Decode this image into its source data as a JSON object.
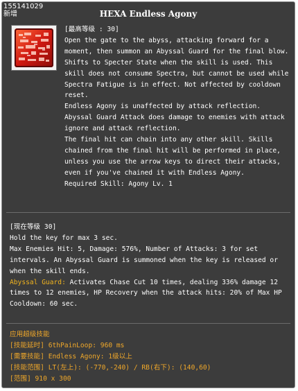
{
  "header": {
    "id": "155141029",
    "status": "新增"
  },
  "skill": {
    "name": "HEXA Endless Agony",
    "max_level_label": "[最高等级 : 30]",
    "description": [
      "Open the gate to the abyss, attacking forward for a moment, then summon an Abyssal Guard for the final blow. Shifts to Specter State when the skill is used. This skill does not consume Spectra, but cannot be used while Spectra Fatigue is in effect. Not affected by cooldown reset.",
      "Endless Agony is unaffected by attack reflection.",
      "Abyssal Guard Attack does damage to enemies with attack ignore and attack reflection.",
      "The final hit can chain into any other skill. Skills chained from the final hit will be performed in place, unless you use the arrow keys to direct their attacks, even if you've chained it with Endless Agony.",
      "Required Skill:  Agony Lv. 1"
    ]
  },
  "current": {
    "label": "[现在等级 30]",
    "line1": "Hold the key for max 3 sec.",
    "line2": "Max Enemies Hit: 5, Damage: 576%, Number of Attacks: 3 for set intervals. An Abyssal Guard is summoned when the key is released or when the skill ends.",
    "guard_label": "Abyssal Guard:",
    "guard_text": " Activates Chase Cut 10 times, dealing 336% damage 12 times to 12 enemies, HP Recovery when the attack hits: 20% of Max HP",
    "cooldown": "Cooldown: 60 sec."
  },
  "super": {
    "title": "应用超级技能",
    "delay": "[技能延时] 6thPainLoop: 960 ms",
    "required": "[需要技能] Endless Agony: 1级以上",
    "range_lt_rb": "[技能范围] LT(左上): (-770,-240) / RB(右下): (140,60)",
    "range": "[范围] 910 x 300"
  },
  "colors": {
    "panel_bg": "#3c3c3c",
    "text": "#ffffff",
    "highlight_gold": "#f0b31f",
    "super_orange": "#f0a82a",
    "icon_red": "#d11a12"
  },
  "icon": "endless-agony-skill-icon"
}
